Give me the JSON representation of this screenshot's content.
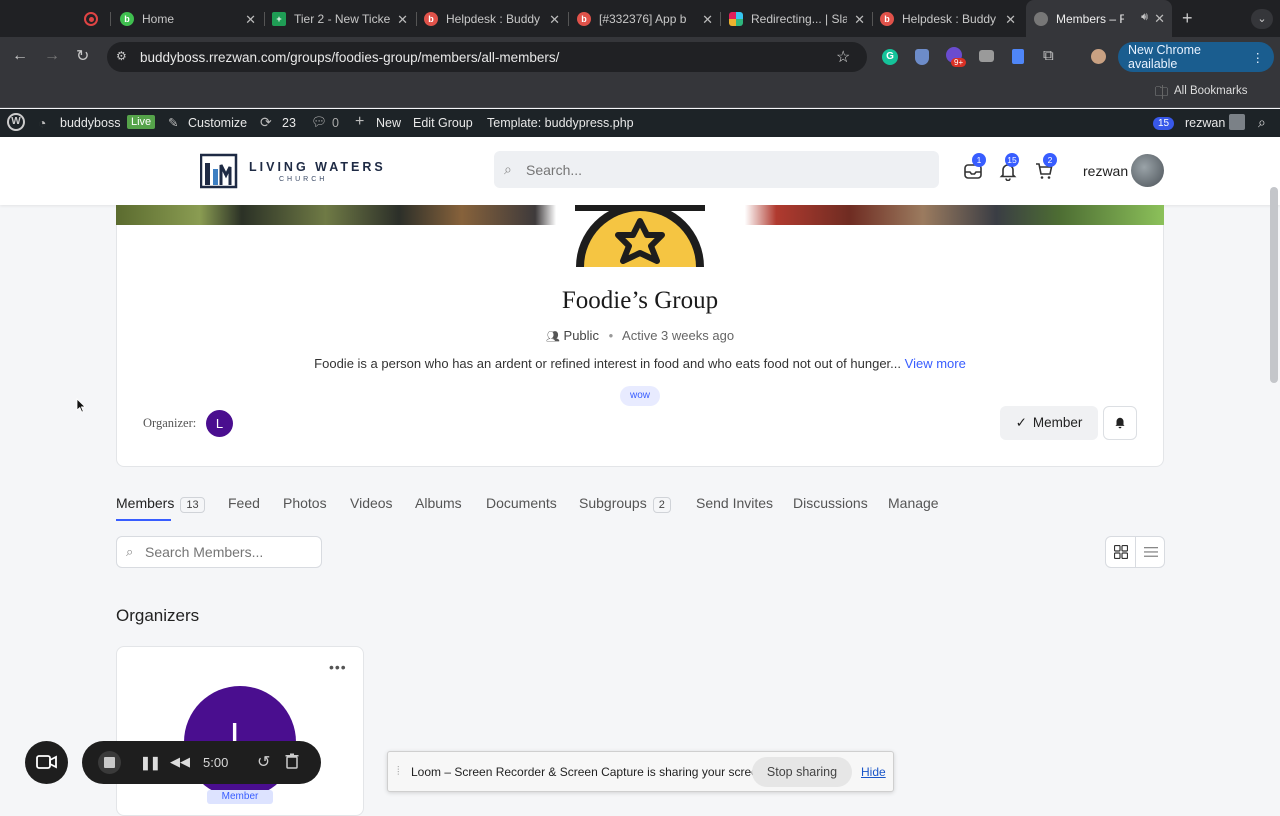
{
  "browser": {
    "tabs": [
      {
        "label": "",
        "color": "#e04444"
      },
      {
        "label": "Home",
        "color": "#3fbf4f"
      },
      {
        "label": "Tier 2 - New Ticke",
        "color": "#1f9d55"
      },
      {
        "label": "Helpdesk : Buddy",
        "color": "#e0524a"
      },
      {
        "label": "[#332376] App b",
        "color": "#e0524a"
      },
      {
        "label": "Redirecting... | Sla",
        "color": "#d9a400"
      },
      {
        "label": "Helpdesk : Buddy",
        "color": "#e0524a"
      },
      {
        "label": "Members – Fo",
        "color": "#888888"
      }
    ],
    "url": "buddyboss.rrezwan.com/groups/foodies-group/members/all-members/",
    "new_chrome": "New Chrome available",
    "ext_badge": "9+",
    "bookmarks_label": "All Bookmarks"
  },
  "wpbar": {
    "site": "buddyboss",
    "live": "Live",
    "customize": "Customize",
    "updates": "23",
    "comments": "0",
    "new": "New",
    "edit_group": "Edit Group",
    "template": "Template: buddypress.php",
    "notif_count": "15",
    "user": "rezwan"
  },
  "header": {
    "logo_line1": "LIVING WATERS",
    "logo_line2": "CHURCH",
    "search_placeholder": "Search...",
    "inbox_count": "1",
    "notif_count": "15",
    "cart_count": "2",
    "username": "rezwan"
  },
  "group": {
    "title": "Foodie’s Group",
    "privacy": "Public",
    "meta_sep": "•",
    "active": "Active 3 weeks ago",
    "description": "Foodie is a person who has an ardent or refined interest in food and who eats food not out of hunger...",
    "view_more": "View more",
    "tag": "wow",
    "organizer_label": "Organizer:",
    "organizer_initial": "L",
    "member_button": "Member"
  },
  "tabs": [
    {
      "label": "Members",
      "count": "13"
    },
    {
      "label": "Feed"
    },
    {
      "label": "Photos"
    },
    {
      "label": "Videos"
    },
    {
      "label": "Albums"
    },
    {
      "label": "Documents"
    },
    {
      "label": "Subgroups",
      "count": "2"
    },
    {
      "label": "Send Invites"
    },
    {
      "label": "Discussions"
    },
    {
      "label": "Manage"
    }
  ],
  "members": {
    "search_placeholder": "Search Members...",
    "section_title": "Organizers",
    "card_initial": "L",
    "card_badge": "Member",
    "card_dots": "•••"
  },
  "loom": {
    "time": "5:00",
    "share_text": "Loom – Screen Recorder & Screen Capture is sharing your screen.",
    "stop_sharing": "Stop sharing",
    "hide": "Hide"
  }
}
